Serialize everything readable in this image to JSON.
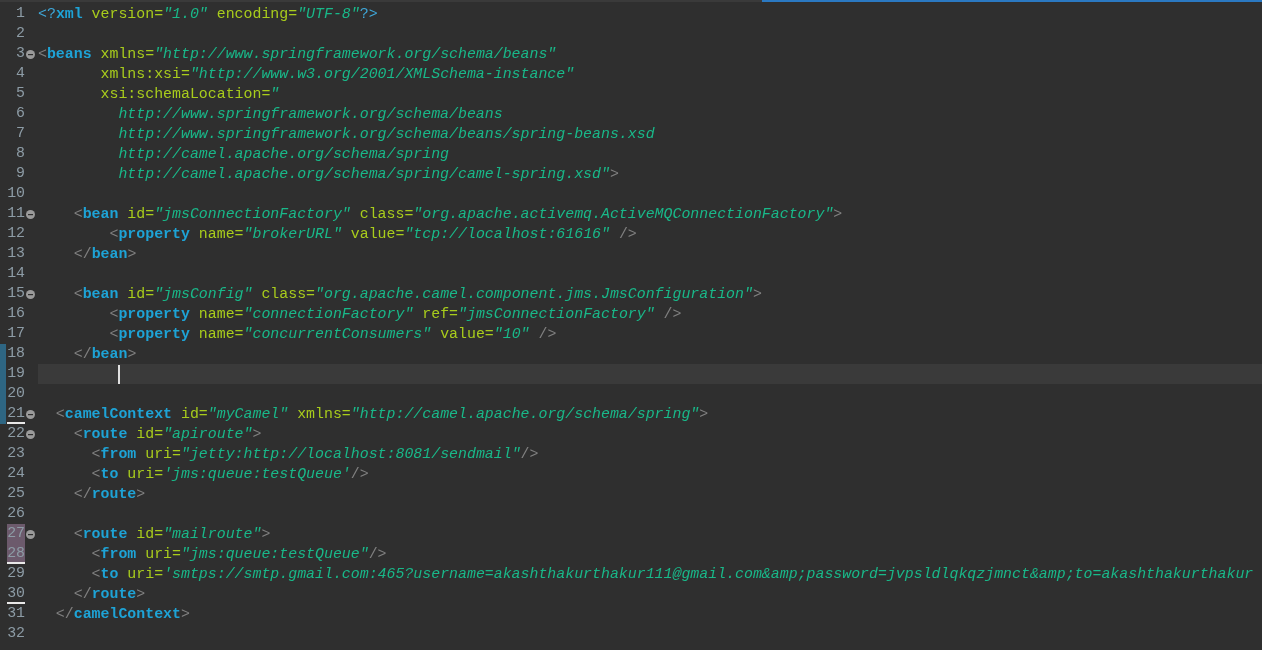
{
  "editor": {
    "lines": [
      {
        "number": "1",
        "foldable": false,
        "changed": false,
        "highlighted": false,
        "underlined": false,
        "current": false,
        "tokens": [
          {
            "kind": "pi",
            "text": "<?"
          },
          {
            "kind": "tag",
            "text": "xml"
          },
          {
            "kind": "attr",
            "text": " version="
          },
          {
            "kind": "value",
            "text": "\"1.0\""
          },
          {
            "kind": "attr",
            "text": " encoding="
          },
          {
            "kind": "value",
            "text": "\"UTF-8\""
          },
          {
            "kind": "pi",
            "text": "?>"
          }
        ]
      },
      {
        "number": "2",
        "foldable": false,
        "changed": false,
        "highlighted": false,
        "underlined": false,
        "current": false
      },
      {
        "number": "3",
        "foldable": true,
        "changed": false,
        "highlighted": false,
        "underlined": false,
        "current": false,
        "tokens": [
          {
            "kind": "bracket",
            "text": "<"
          },
          {
            "kind": "tag",
            "text": "beans"
          },
          {
            "kind": "attr",
            "text": " xmlns="
          },
          {
            "kind": "value",
            "text": "\"http://www.springframework.org/schema/beans\""
          }
        ]
      },
      {
        "number": "4",
        "foldable": false,
        "changed": false,
        "highlighted": false,
        "underlined": false,
        "current": false,
        "tokens": [
          {
            "kind": "attr",
            "text": "       xmlns:xsi="
          },
          {
            "kind": "value",
            "text": "\"http://www.w3.org/2001/XMLSchema-instance\""
          }
        ]
      },
      {
        "number": "5",
        "foldable": false,
        "changed": false,
        "highlighted": false,
        "underlined": false,
        "current": false,
        "tokens": [
          {
            "kind": "attr",
            "text": "       xsi:schemaLocation="
          },
          {
            "kind": "value",
            "text": "\""
          }
        ]
      },
      {
        "number": "6",
        "foldable": false,
        "changed": false,
        "highlighted": false,
        "underlined": false,
        "current": false,
        "tokens": [
          {
            "kind": "value",
            "text": "         http://www.springframework.org/schema/beans"
          }
        ]
      },
      {
        "number": "7",
        "foldable": false,
        "changed": false,
        "highlighted": false,
        "underlined": false,
        "current": false,
        "tokens": [
          {
            "kind": "value",
            "text": "         http://www.springframework.org/schema/beans/spring-beans.xsd"
          }
        ]
      },
      {
        "number": "8",
        "foldable": false,
        "changed": false,
        "highlighted": false,
        "underlined": false,
        "current": false,
        "tokens": [
          {
            "kind": "value",
            "text": "         http://camel.apache.org/schema/spring"
          }
        ]
      },
      {
        "number": "9",
        "foldable": false,
        "changed": false,
        "highlighted": false,
        "underlined": false,
        "current": false,
        "tokens": [
          {
            "kind": "value",
            "text": "         http://camel.apache.org/schema/spring/camel-spring.xsd\""
          },
          {
            "kind": "bracket",
            "text": ">"
          }
        ]
      },
      {
        "number": "10",
        "foldable": false,
        "changed": false,
        "highlighted": false,
        "underlined": false,
        "current": false
      },
      {
        "number": "11",
        "foldable": true,
        "changed": false,
        "highlighted": false,
        "underlined": false,
        "current": false,
        "tokens": [
          {
            "kind": "bracket",
            "text": "    <"
          },
          {
            "kind": "tag",
            "text": "bean"
          },
          {
            "kind": "attr",
            "text": " id="
          },
          {
            "kind": "value",
            "text": "\"jmsConnectionFactory\""
          },
          {
            "kind": "attr",
            "text": " class="
          },
          {
            "kind": "value",
            "text": "\"org.apache.activemq.ActiveMQConnectionFactory\""
          },
          {
            "kind": "bracket",
            "text": ">"
          }
        ]
      },
      {
        "number": "12",
        "foldable": false,
        "changed": false,
        "highlighted": false,
        "underlined": false,
        "current": false,
        "tokens": [
          {
            "kind": "bracket",
            "text": "        <"
          },
          {
            "kind": "tag",
            "text": "property"
          },
          {
            "kind": "attr",
            "text": " name="
          },
          {
            "kind": "value",
            "text": "\"brokerURL\""
          },
          {
            "kind": "attr",
            "text": " value="
          },
          {
            "kind": "value",
            "text": "\"tcp://localhost:61616\""
          },
          {
            "kind": "bracket",
            "text": " />"
          }
        ]
      },
      {
        "number": "13",
        "foldable": false,
        "changed": false,
        "highlighted": false,
        "underlined": false,
        "current": false,
        "tokens": [
          {
            "kind": "bracket",
            "text": "    </"
          },
          {
            "kind": "tag",
            "text": "bean"
          },
          {
            "kind": "bracket",
            "text": ">"
          }
        ]
      },
      {
        "number": "14",
        "foldable": false,
        "changed": false,
        "highlighted": false,
        "underlined": false,
        "current": false
      },
      {
        "number": "15",
        "foldable": true,
        "changed": false,
        "highlighted": false,
        "underlined": false,
        "current": false,
        "tokens": [
          {
            "kind": "bracket",
            "text": "    <"
          },
          {
            "kind": "tag",
            "text": "bean"
          },
          {
            "kind": "attr",
            "text": " id="
          },
          {
            "kind": "value",
            "text": "\"jmsConfig\""
          },
          {
            "kind": "attr",
            "text": " class="
          },
          {
            "kind": "value",
            "text": "\"org.apache.camel.component.jms.JmsConfiguration\""
          },
          {
            "kind": "bracket",
            "text": ">"
          }
        ]
      },
      {
        "number": "16",
        "foldable": false,
        "changed": false,
        "highlighted": false,
        "underlined": false,
        "current": false,
        "tokens": [
          {
            "kind": "bracket",
            "text": "        <"
          },
          {
            "kind": "tag",
            "text": "property"
          },
          {
            "kind": "attr",
            "text": " name="
          },
          {
            "kind": "value",
            "text": "\"connectionFactory\""
          },
          {
            "kind": "attr",
            "text": " ref="
          },
          {
            "kind": "value",
            "text": "\"jmsConnectionFactory\""
          },
          {
            "kind": "bracket",
            "text": " />"
          }
        ]
      },
      {
        "number": "17",
        "foldable": false,
        "changed": false,
        "highlighted": false,
        "underlined": false,
        "current": false,
        "tokens": [
          {
            "kind": "bracket",
            "text": "        <"
          },
          {
            "kind": "tag",
            "text": "property"
          },
          {
            "kind": "attr",
            "text": " name="
          },
          {
            "kind": "value",
            "text": "\"concurrentConsumers\""
          },
          {
            "kind": "attr",
            "text": " value="
          },
          {
            "kind": "value",
            "text": "\"10\""
          },
          {
            "kind": "bracket",
            "text": " />"
          }
        ]
      },
      {
        "number": "18",
        "foldable": false,
        "changed": true,
        "highlighted": false,
        "underlined": false,
        "current": false,
        "tokens": [
          {
            "kind": "bracket",
            "text": "    </"
          },
          {
            "kind": "tag",
            "text": "bean"
          },
          {
            "kind": "bracket",
            "text": ">"
          }
        ]
      },
      {
        "number": "19",
        "foldable": false,
        "changed": true,
        "highlighted": false,
        "underlined": false,
        "current": true
      },
      {
        "number": "20",
        "foldable": false,
        "changed": true,
        "highlighted": false,
        "underlined": false,
        "current": false
      },
      {
        "number": "21",
        "foldable": true,
        "changed": true,
        "highlighted": false,
        "underlined": true,
        "current": false,
        "tokens": [
          {
            "kind": "bracket",
            "text": "  <"
          },
          {
            "kind": "tag",
            "text": "camelContext"
          },
          {
            "kind": "attr",
            "text": " id="
          },
          {
            "kind": "value",
            "text": "\"myCamel\""
          },
          {
            "kind": "attr",
            "text": " xmlns="
          },
          {
            "kind": "value",
            "text": "\"http://camel.apache.org/schema/spring\""
          },
          {
            "kind": "bracket",
            "text": ">"
          }
        ]
      },
      {
        "number": "22",
        "foldable": true,
        "changed": false,
        "highlighted": false,
        "underlined": false,
        "current": false,
        "tokens": [
          {
            "kind": "bracket",
            "text": "    <"
          },
          {
            "kind": "tag",
            "text": "route"
          },
          {
            "kind": "attr",
            "text": " id="
          },
          {
            "kind": "value",
            "text": "\"apiroute\""
          },
          {
            "kind": "bracket",
            "text": ">"
          }
        ]
      },
      {
        "number": "23",
        "foldable": false,
        "changed": false,
        "highlighted": false,
        "underlined": false,
        "current": false,
        "tokens": [
          {
            "kind": "bracket",
            "text": "      <"
          },
          {
            "kind": "tag",
            "text": "from"
          },
          {
            "kind": "attr",
            "text": " uri="
          },
          {
            "kind": "value",
            "text": "\"jetty:http://localhost:8081/sendmail\""
          },
          {
            "kind": "bracket",
            "text": "/>"
          }
        ]
      },
      {
        "number": "24",
        "foldable": false,
        "changed": false,
        "highlighted": false,
        "underlined": false,
        "current": false,
        "tokens": [
          {
            "kind": "bracket",
            "text": "      <"
          },
          {
            "kind": "tag",
            "text": "to"
          },
          {
            "kind": "attr",
            "text": " uri="
          },
          {
            "kind": "value",
            "text": "'jms:queue:testQueue'"
          },
          {
            "kind": "bracket",
            "text": "/>"
          }
        ]
      },
      {
        "number": "25",
        "foldable": false,
        "changed": false,
        "highlighted": false,
        "underlined": false,
        "current": false,
        "tokens": [
          {
            "kind": "bracket",
            "text": "    </"
          },
          {
            "kind": "tag",
            "text": "route"
          },
          {
            "kind": "bracket",
            "text": ">"
          }
        ]
      },
      {
        "number": "26",
        "foldable": false,
        "changed": false,
        "highlighted": false,
        "underlined": false,
        "current": false
      },
      {
        "number": "27",
        "foldable": true,
        "changed": false,
        "highlighted": true,
        "underlined": false,
        "current": false,
        "tokens": [
          {
            "kind": "bracket",
            "text": "    <"
          },
          {
            "kind": "tag",
            "text": "route"
          },
          {
            "kind": "attr",
            "text": " id="
          },
          {
            "kind": "value",
            "text": "\"mailroute\""
          },
          {
            "kind": "bracket",
            "text": ">"
          }
        ]
      },
      {
        "number": "28",
        "foldable": false,
        "changed": false,
        "highlighted": true,
        "underlined": true,
        "current": false,
        "tokens": [
          {
            "kind": "bracket",
            "text": "      <"
          },
          {
            "kind": "tag",
            "text": "from"
          },
          {
            "kind": "attr",
            "text": " uri="
          },
          {
            "kind": "value",
            "text": "\"jms:queue:testQueue\""
          },
          {
            "kind": "bracket",
            "text": "/>"
          }
        ]
      },
      {
        "number": "29",
        "foldable": false,
        "changed": false,
        "highlighted": false,
        "underlined": false,
        "current": false,
        "tokens": [
          {
            "kind": "bracket",
            "text": "      <"
          },
          {
            "kind": "tag",
            "text": "to"
          },
          {
            "kind": "attr",
            "text": " uri="
          },
          {
            "kind": "value",
            "text": "'smtps://smtp.gmail.com:465?username=akashthakurthakur111@gmail.com&amp;password=jvpsldlqkqzjmnct&amp;to=akashthakurthakur"
          }
        ]
      },
      {
        "number": "30",
        "foldable": false,
        "changed": false,
        "highlighted": false,
        "underlined": true,
        "current": false,
        "tokens": [
          {
            "kind": "bracket",
            "text": "    </"
          },
          {
            "kind": "tag",
            "text": "route"
          },
          {
            "kind": "bracket",
            "text": ">"
          }
        ]
      },
      {
        "number": "31",
        "foldable": false,
        "changed": false,
        "highlighted": false,
        "underlined": false,
        "current": false,
        "tokens": [
          {
            "kind": "bracket",
            "text": "  </"
          },
          {
            "kind": "tag",
            "text": "camelContext"
          },
          {
            "kind": "bracket",
            "text": ">"
          }
        ]
      },
      {
        "number": "32",
        "foldable": false,
        "changed": false,
        "highlighted": false,
        "underlined": false,
        "current": false
      }
    ]
  }
}
